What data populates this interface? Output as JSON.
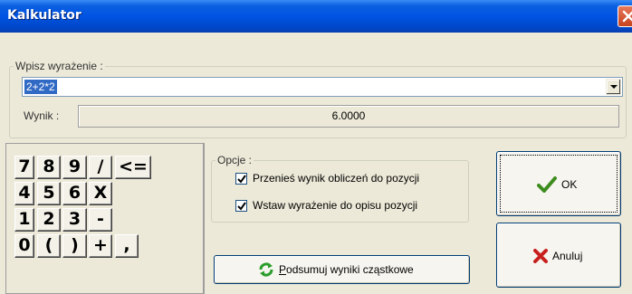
{
  "window": {
    "title": "Kalkulator"
  },
  "expression": {
    "legend": "Wpisz wyrażenie :",
    "value": "2+2*2"
  },
  "result": {
    "label": "Wynik :",
    "value": "6.0000"
  },
  "keypad": {
    "keys": [
      "7",
      "8",
      "9",
      "/",
      "<=",
      "4",
      "5",
      "6",
      "X",
      "1",
      "2",
      "3",
      "-",
      "0",
      "(",
      ")",
      "+",
      ","
    ]
  },
  "options": {
    "legend": "Opcje :",
    "items": [
      {
        "label": "Przenieś wynik obliczeń do pozycji",
        "checked": true
      },
      {
        "label": "Wstaw wyrażenie do opisu pozycji",
        "checked": true
      }
    ]
  },
  "buttons": {
    "ok": "OK",
    "cancel": "Anuluj",
    "summary_accel": "P",
    "summary_rest": "odsumuj wyniki cząstkowe"
  },
  "icons": {
    "close": "close-icon",
    "dropdown": "chevron-down-icon",
    "ok": "checkmark-icon",
    "cancel": "x-icon",
    "summary": "refresh-icon"
  },
  "colors": {
    "title_bar": "#0054e3",
    "selection": "#316ac5",
    "ok_icon": "#3c8c1e",
    "cancel_icon": "#c8201e",
    "summary_icon": "#2a9d2a"
  }
}
